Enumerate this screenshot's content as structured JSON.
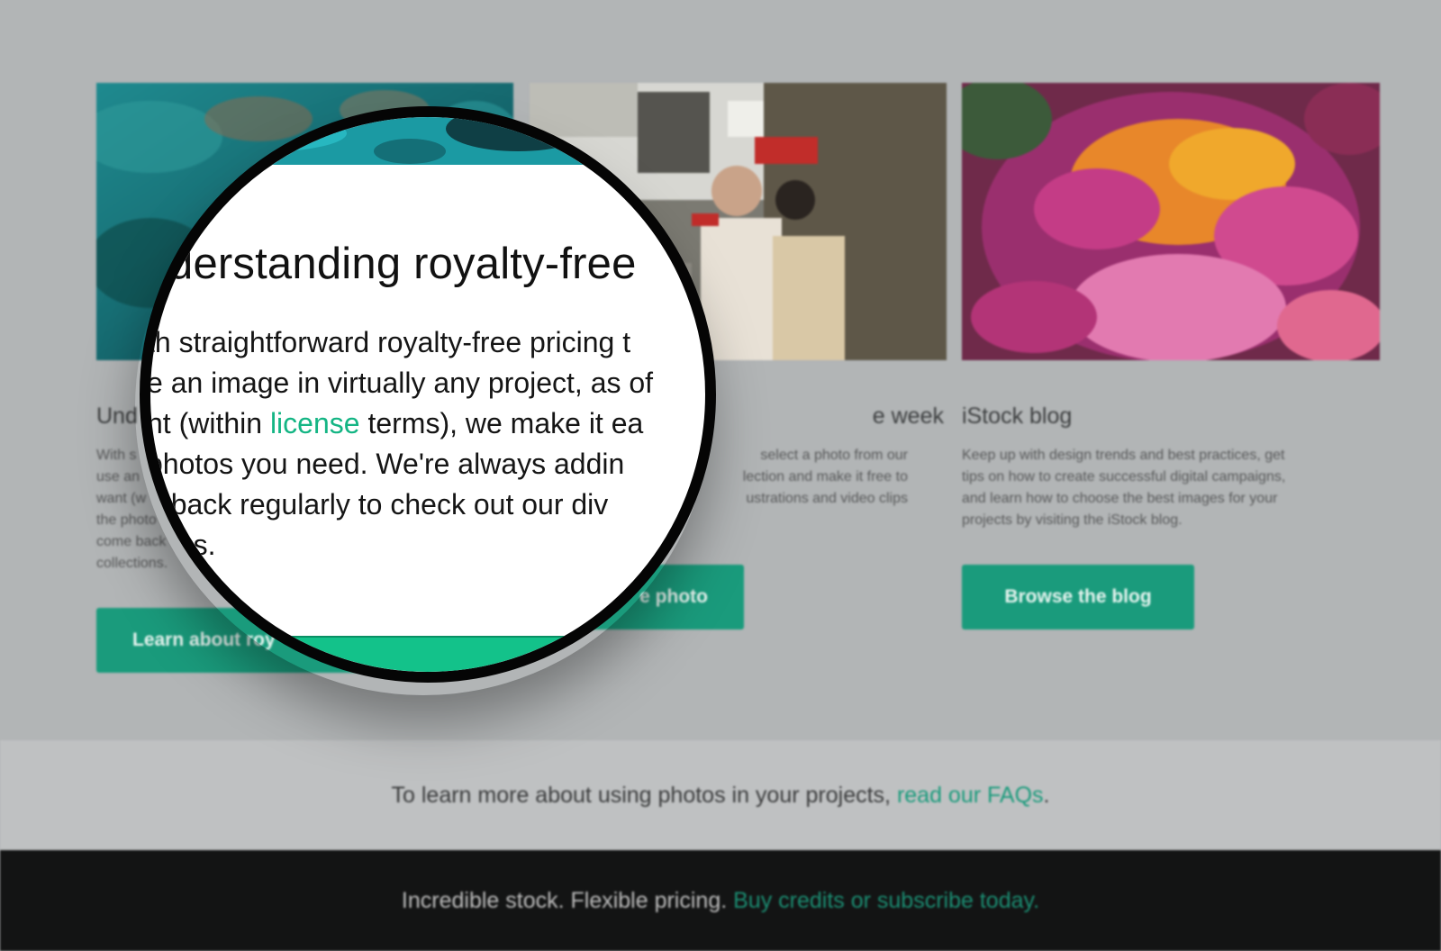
{
  "cards": [
    {
      "title": "Und",
      "desc_lines": [
        "With s",
        "use an",
        "want (w",
        "the photo",
        "come back",
        "collections."
      ],
      "button": "Learn about roy"
    },
    {
      "title": "e week",
      "desc_lines": [
        "select a photo from our",
        "lection and make it free to",
        "ustrations and video clips"
      ],
      "button": "e photo"
    },
    {
      "title": "iStock blog",
      "desc_lines": [
        "Keep up with design trends and best practices, get",
        "tips on how to create successful digital campaigns,",
        "and learn how to choose the best images for your",
        "projects by visiting the iStock blog."
      ],
      "button": "Browse the blog"
    }
  ],
  "faq": {
    "text": "To learn more about using photos in your projects, ",
    "link": "read our FAQs",
    "end": "."
  },
  "footer": {
    "text": "Incredible stock. Flexible pricing. ",
    "link": "Buy credits or subscribe today."
  },
  "magnifier": {
    "title": "derstanding royalty-free",
    "lines": [
      "th straightforward royalty-free pricing t",
      "e an image in virtually any project, as of",
      "nt (within ",
      "photos you need. We're always addin",
      "e back regularly to check out our div",
      "tions."
    ],
    "line3_link": "license",
    "line3_end": " terms), we make it ea"
  },
  "colors": {
    "accent": "#1a9b7c",
    "lens_accent": "#13c28a",
    "footer_bg": "#131414"
  }
}
